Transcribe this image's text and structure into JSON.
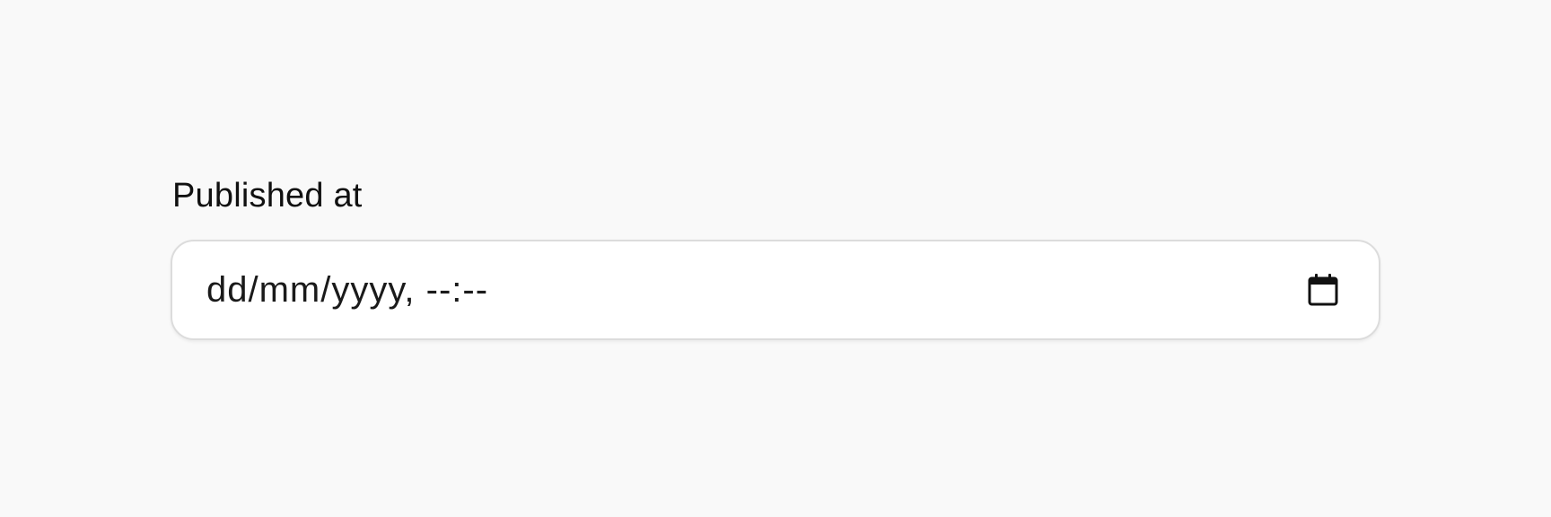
{
  "field": {
    "label": "Published at",
    "placeholder": "dd/mm/yyyy, --:--",
    "icon": "calendar-icon"
  }
}
